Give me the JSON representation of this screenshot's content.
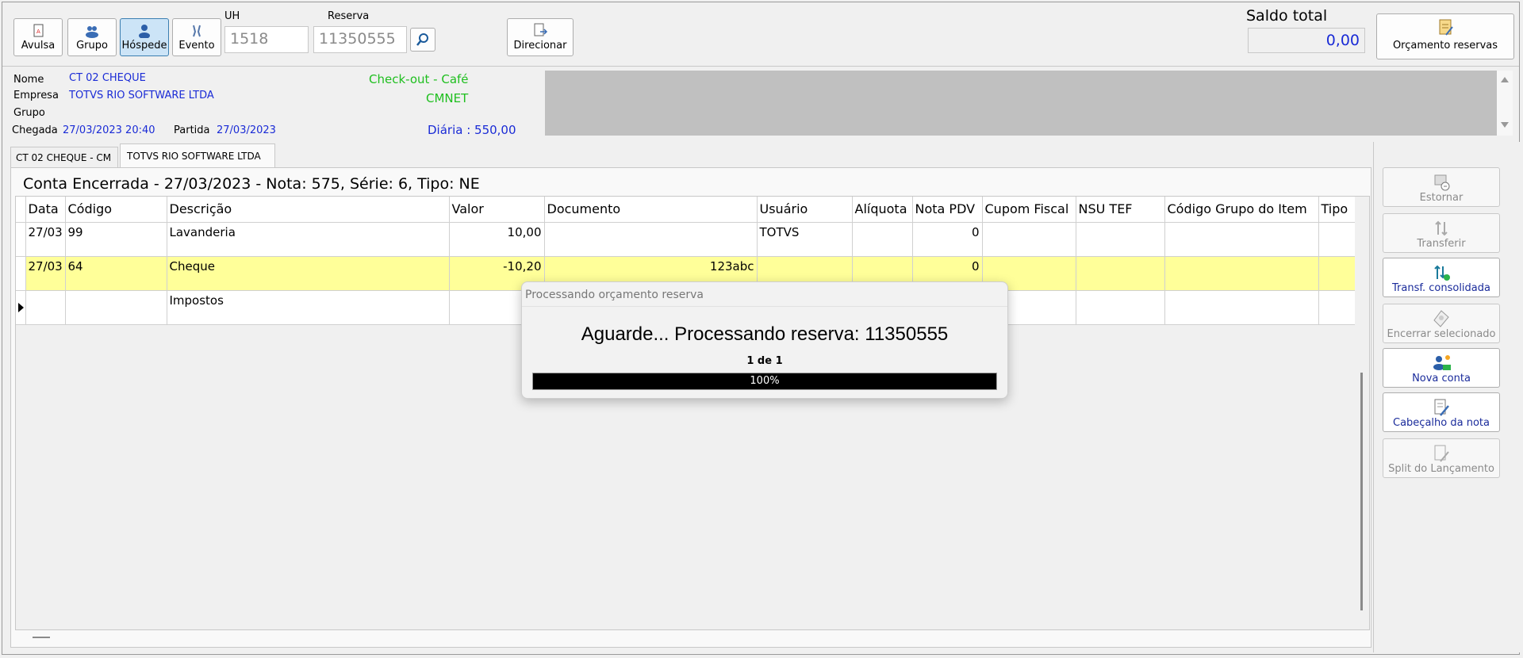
{
  "toolbar": {
    "modes": [
      {
        "label": "Avulsa",
        "icon": "document-icon"
      },
      {
        "label": "Grupo",
        "icon": "group-icon"
      },
      {
        "label": "Hóspede",
        "icon": "guest-icon"
      },
      {
        "label": "Evento",
        "icon": "event-icon"
      }
    ],
    "uh_label": "UH",
    "uh_value": "1518",
    "reserva_label": "Reserva",
    "reserva_value": "11350555",
    "direcionar_label": "Direcionar",
    "saldo_label": "Saldo total",
    "saldo_value": "0,00",
    "orcamento_label": "Orçamento reservas"
  },
  "guest": {
    "nome_label": "Nome",
    "nome_value": "CT 02 CHEQUE",
    "empresa_label": "Empresa",
    "empresa_value": "TOTVS RIO SOFTWARE LTDA",
    "grupo_label": "Grupo",
    "chegada_label": "Chegada",
    "chegada_value": "27/03/2023 20:40",
    "partida_label": "Partida",
    "partida_value": "27/03/2023",
    "checkout_text": "Check-out -  Café",
    "cmnet_text": "CMNET",
    "diaria_text": "Diária : 550,00"
  },
  "tabs": [
    {
      "label": "CT 02 CHEQUE - CM"
    },
    {
      "label": "TOTVS RIO SOFTWARE LTDA"
    }
  ],
  "account": {
    "title": "Conta Encerrada - 27/03/2023 - Nota: 575, Série: 6, Tipo: NE",
    "columns": [
      "Data",
      "Código",
      "Descrição",
      "Valor",
      "Documento",
      "Usuário",
      "Alíquota",
      "Nota PDV",
      "Cupom Fiscal",
      "NSU TEF",
      "Código Grupo do Item",
      "Tipo"
    ],
    "rows": [
      {
        "data": "27/03",
        "codigo": "99",
        "descricao": "Lavanderia",
        "valor": "10,00",
        "documento": "",
        "usuario": "TOTVS",
        "aliquota": "",
        "nota_pdv": "0",
        "cupom": "",
        "nsu": "",
        "grupo_item": "",
        "tipo": ""
      },
      {
        "data": "27/03",
        "codigo": "64",
        "descricao": "Cheque",
        "valor": "-10,20",
        "documento": "123abc",
        "usuario": "",
        "aliquota": "",
        "nota_pdv": "0",
        "cupom": "",
        "nsu": "",
        "grupo_item": "",
        "tipo": ""
      },
      {
        "data": "",
        "codigo": "",
        "descricao": "Impostos",
        "valor": "",
        "documento": "",
        "usuario": "",
        "aliquota": "",
        "nota_pdv": "",
        "cupom": "",
        "nsu": "",
        "grupo_item": "",
        "tipo": ""
      }
    ]
  },
  "side_actions": [
    {
      "label": "Estornar",
      "icon": "undo-icon",
      "enabled": false
    },
    {
      "label": "Transferir",
      "icon": "transfer-icon",
      "enabled": false
    },
    {
      "label": "Transf. consolidada",
      "icon": "transfer-consolidated-icon",
      "enabled": true
    },
    {
      "label": "Encerrar selecionado",
      "icon": "close-account-icon",
      "enabled": false
    },
    {
      "label": "Nova conta",
      "icon": "new-account-icon",
      "enabled": true
    },
    {
      "label": "Cabeçalho da nota",
      "icon": "edit-note-icon",
      "enabled": true
    },
    {
      "label": "Split do Lançamento",
      "icon": "split-icon",
      "enabled": false
    }
  ],
  "progress": {
    "title": "Processando orçamento reserva",
    "message": "Aguarde... Processando reserva: 11350555",
    "count": "1 de 1",
    "percent_text": "100%",
    "fraction": 1.0
  },
  "colors": {
    "highlight_row": "#ffff99",
    "link_blue": "#1a2bd6",
    "status_green": "#1fbf1f",
    "active_mode": "#cce4f7"
  }
}
